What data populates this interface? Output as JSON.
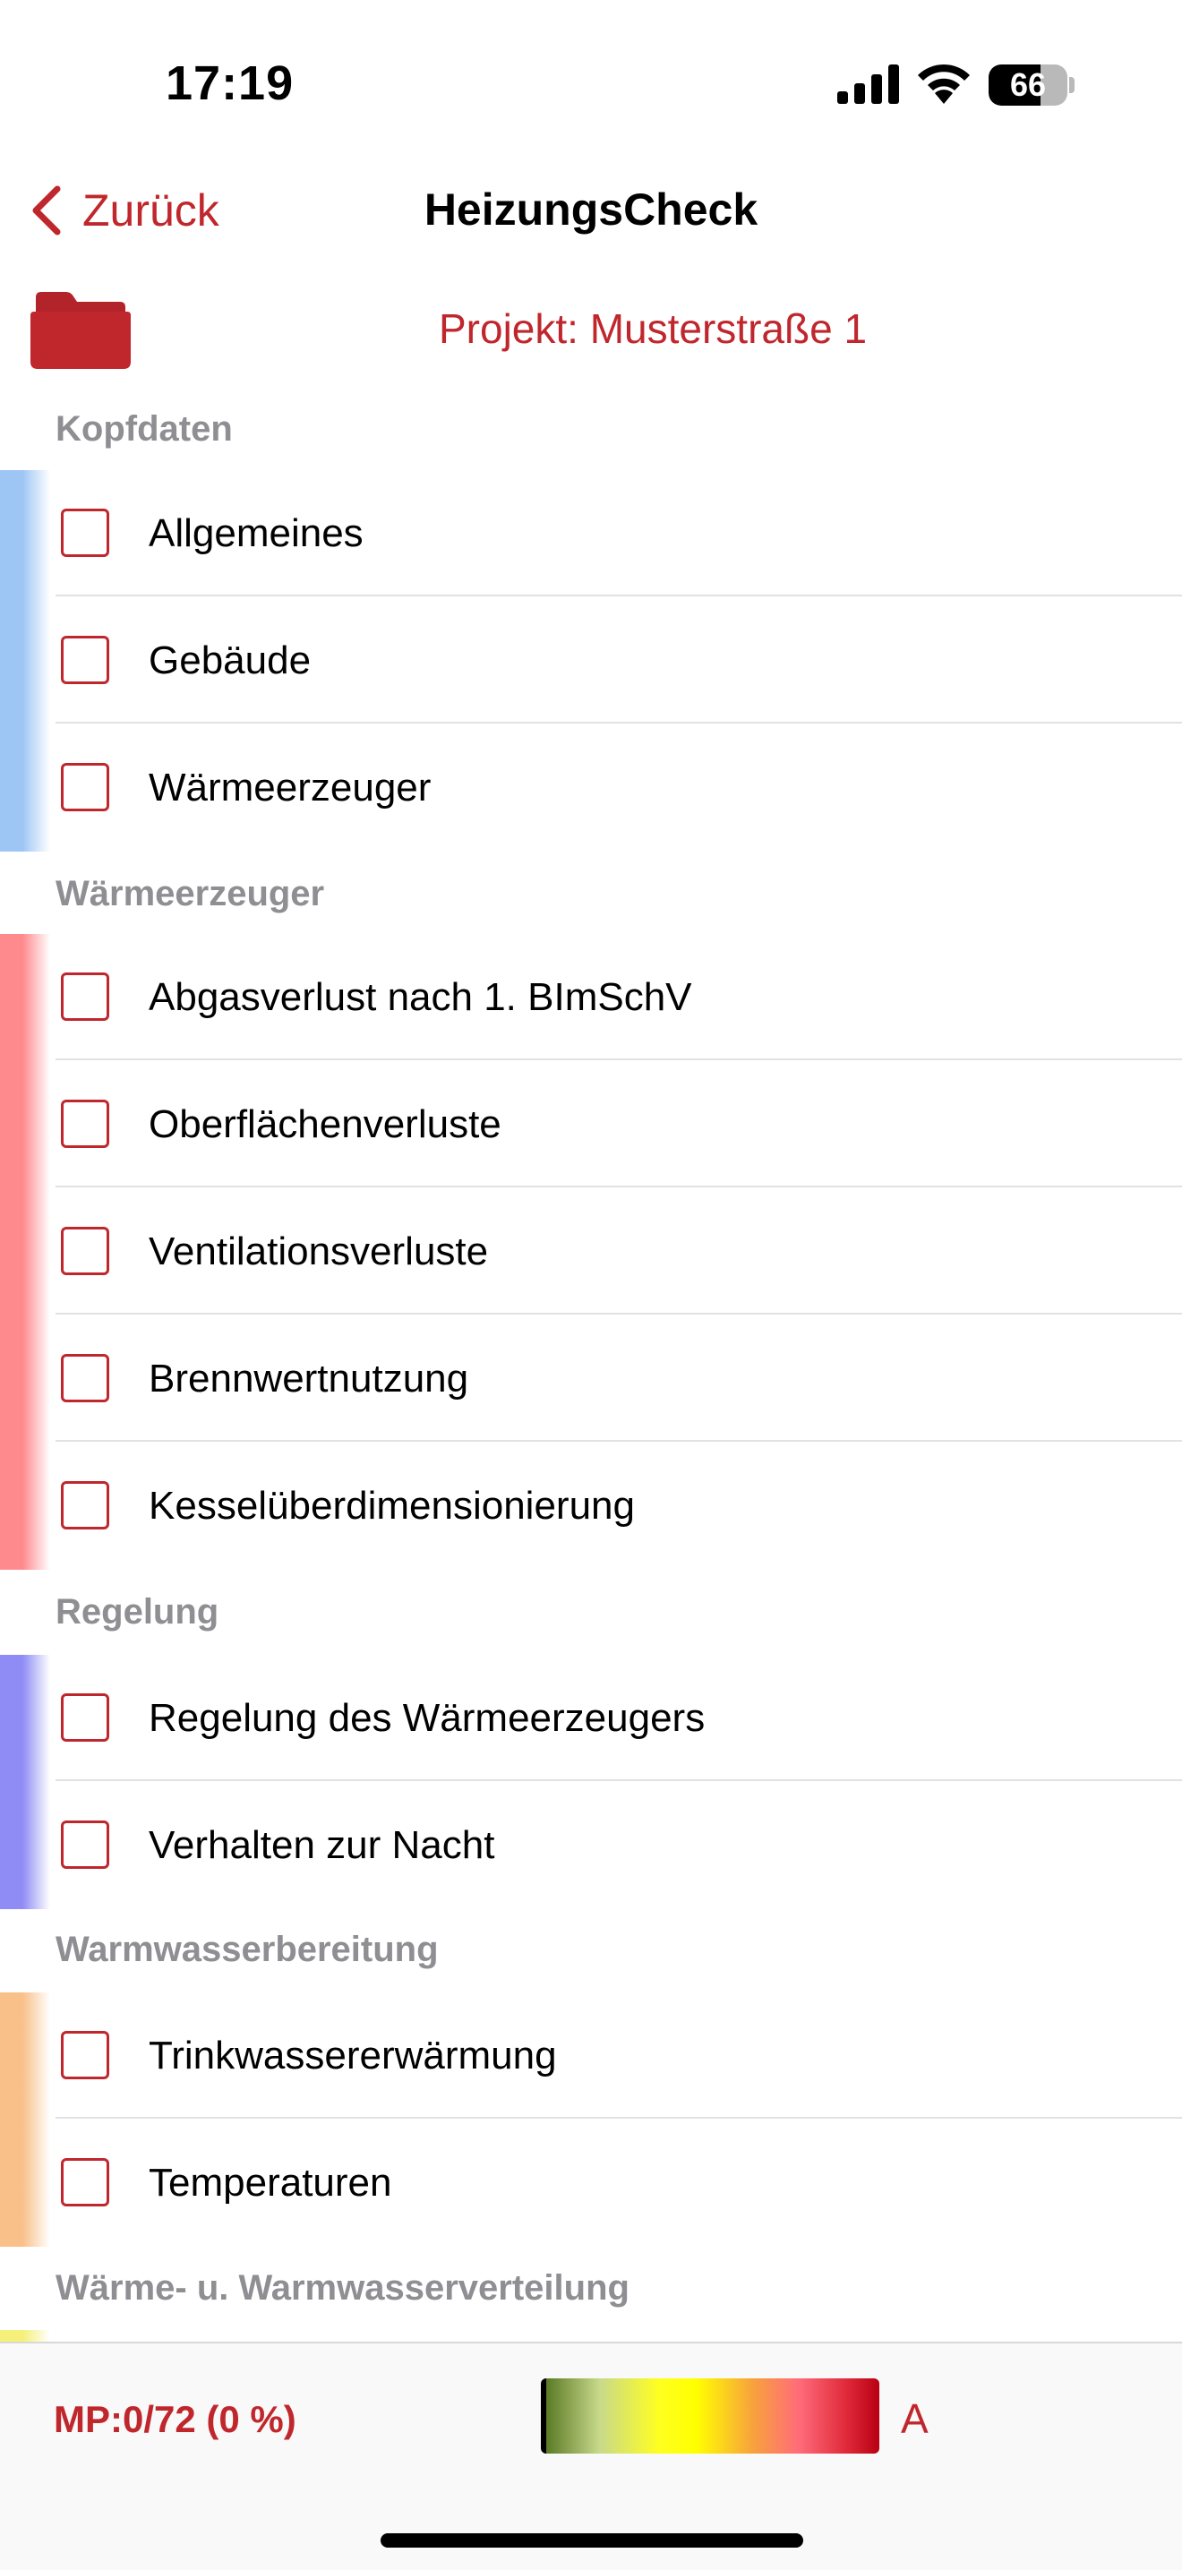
{
  "status_bar": {
    "time": "17:19",
    "battery_level": "66",
    "icons": [
      "cellular-signal-icon",
      "wifi-icon",
      "battery-icon"
    ]
  },
  "nav": {
    "back_label": "Zurück",
    "title": "HeizungsCheck"
  },
  "project": {
    "icon": "folder-icon",
    "label": "Projekt: Musterstraße 1"
  },
  "sections": [
    {
      "title": "Kopfdaten",
      "accent_color": "#9ec6f5",
      "items": [
        {
          "label": "Allgemeines",
          "checked": false
        },
        {
          "label": "Gebäude",
          "checked": false
        },
        {
          "label": "Wärmeerzeuger",
          "checked": false
        }
      ]
    },
    {
      "title": "Wärmeerzeuger",
      "accent_color": "#ff8a8e",
      "items": [
        {
          "label": "Abgasverlust nach 1. BImSchV",
          "checked": false
        },
        {
          "label": "Oberflächenverluste",
          "checked": false
        },
        {
          "label": "Ventilationsverluste",
          "checked": false
        },
        {
          "label": "Brennwertnutzung",
          "checked": false
        },
        {
          "label": "Kesselüberdimensionierung",
          "checked": false
        }
      ]
    },
    {
      "title": "Regelung",
      "accent_color": "#8f8df5",
      "items": [
        {
          "label": "Regelung des Wärmeerzeugers",
          "checked": false
        },
        {
          "label": "Verhalten zur Nacht",
          "checked": false
        }
      ]
    },
    {
      "title": "Warmwasserbereitung",
      "accent_color": "#f9c08a",
      "items": [
        {
          "label": "Trinkwassererwärmung",
          "checked": false
        },
        {
          "label": "Temperaturen",
          "checked": false
        }
      ]
    },
    {
      "title": "Wärme- u. Warmwasserverteilung",
      "accent_color": "#f5f07a",
      "items": []
    }
  ],
  "bottom_bar": {
    "progress": "MP:0/72 (0 %)",
    "rating_letter": "A",
    "accent_color": "#c0272d"
  }
}
